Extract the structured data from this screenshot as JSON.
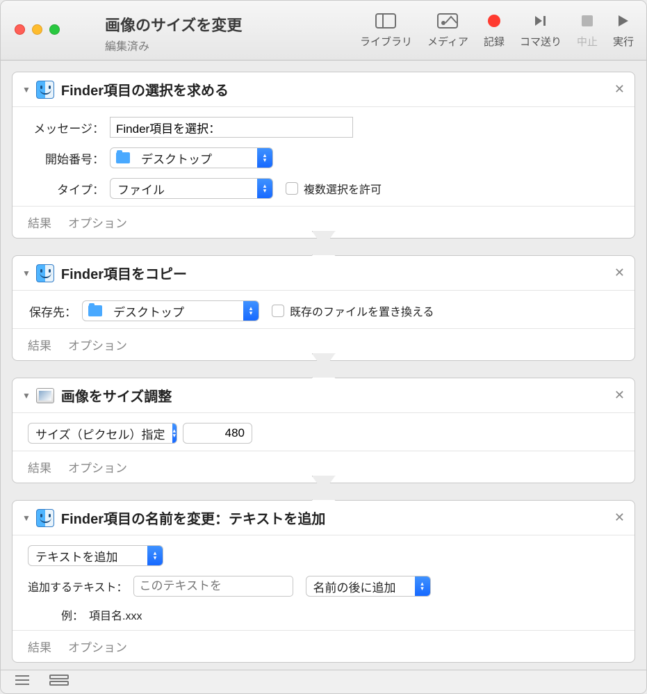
{
  "titlebar": {
    "title": "画像のサイズを変更",
    "subtitle": "編集済み"
  },
  "toolbar": {
    "library": "ライブラリ",
    "media": "メディア",
    "record": "記録",
    "step": "コマ送り",
    "stop": "中止",
    "run": "実行"
  },
  "actions": [
    {
      "title": "Finder項目の選択を求める",
      "fields": {
        "message_label": "メッセージ：",
        "message_value": "Finder項目を選択：",
        "start_label": "開始番号：",
        "start_value": "デスクトップ",
        "type_label": "タイプ：",
        "type_value": "ファイル",
        "allow_multi_label": "複数選択を許可"
      }
    },
    {
      "title": "Finder項目をコピー",
      "fields": {
        "dest_label": "保存先：",
        "dest_value": "デスクトップ",
        "replace_label": "既存のファイルを置き換える"
      }
    },
    {
      "title": "画像をサイズ調整",
      "fields": {
        "mode_value": "サイズ（ピクセル）指定",
        "size_value": "480"
      }
    },
    {
      "title": "Finder項目の名前を変更：テキストを追加",
      "fields": {
        "mode_value": "テキストを追加",
        "addtext_label": "追加するテキスト：",
        "addtext_placeholder": "このテキストを",
        "position_value": "名前の後に追加",
        "example_label": "例：",
        "example_value": "項目名.xxx"
      }
    }
  ],
  "footer": {
    "results": "結果",
    "options": "オプション"
  }
}
